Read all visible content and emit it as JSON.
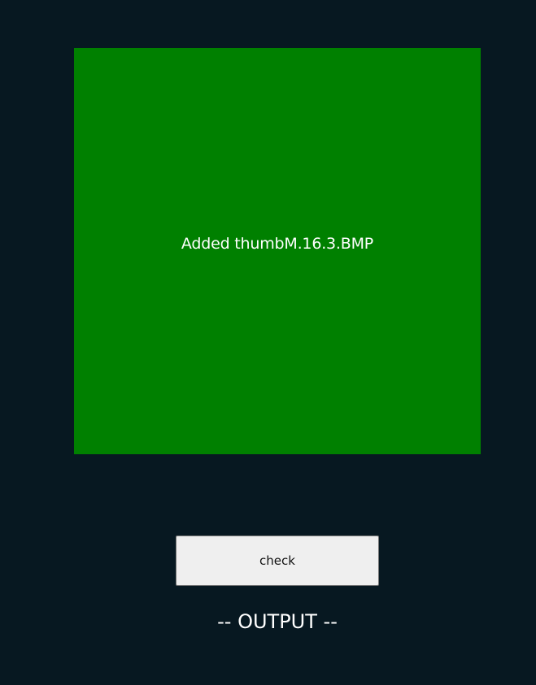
{
  "drop_zone": {
    "status_text": "Added thumbM.16.3.BMP",
    "color": "#008000"
  },
  "actions": {
    "check_label": "check"
  },
  "output": {
    "label": "-- OUTPUT --"
  },
  "theme": {
    "background": "#071821",
    "button_background": "#efefef"
  }
}
